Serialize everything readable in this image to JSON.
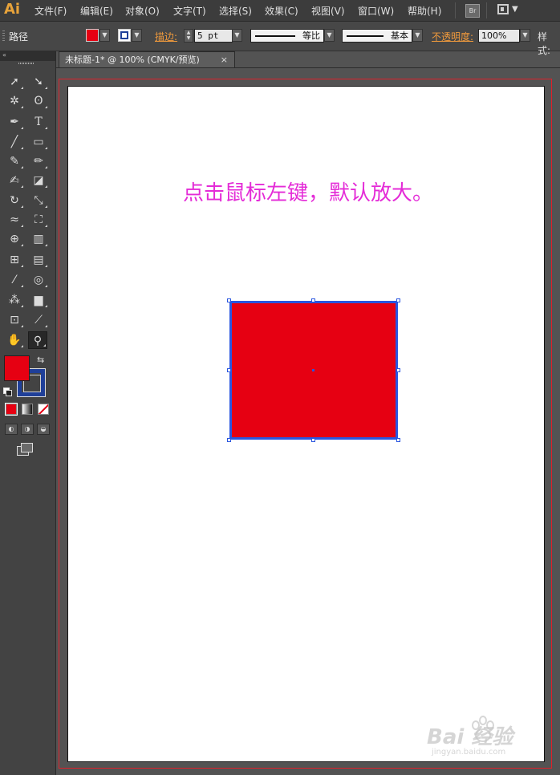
{
  "app": {
    "logo": "Ai",
    "menu": [
      "文件(F)",
      "编辑(E)",
      "对象(O)",
      "文字(T)",
      "选择(S)",
      "效果(C)",
      "视图(V)",
      "窗口(W)",
      "帮助(H)"
    ],
    "bridge_label": "Br"
  },
  "control_bar": {
    "selection_type": "路径",
    "fill_color": "#e60012",
    "stroke_label": "描边:",
    "stroke_weight": "5 pt",
    "stroke_profile": "等比",
    "brush": "基本",
    "opacity_label": "不透明度:",
    "opacity_value": "100%",
    "style_label": "样式:"
  },
  "document_tab": {
    "title": "未标题-1* @ 100% (CMYK/预览)",
    "close": "×"
  },
  "canvas": {
    "instruction_text": "点击鼠标左键，默认放大。",
    "rect_color": "#e60012",
    "selection_color": "#2a56e0"
  },
  "tools_panel": {
    "header": "«",
    "fill_color": "#e60012",
    "stroke_color": "#1f3f99",
    "active_tool": "zoom-tool"
  },
  "watermark": {
    "brand": "Bai  经验",
    "url": "jingyan.baidu.com"
  }
}
